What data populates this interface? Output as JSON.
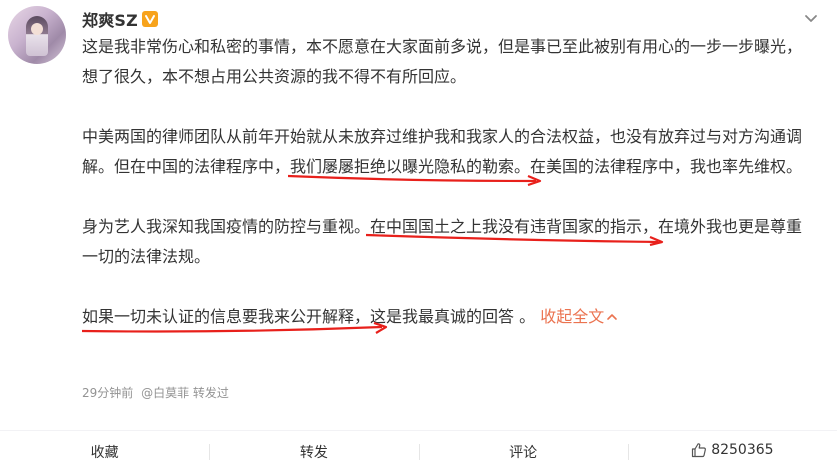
{
  "post": {
    "username": "郑爽SZ",
    "verified_icon": "v-badge-icon",
    "paragraphs": {
      "p1": "这是我非常伤心和私密的事情，本不愿意在大家面前多说，但是事已至此被别有用心的一步一步曝光，想了很久，本不想占用公共资源的我不得不有所回应。",
      "p2_a": "中美两国的律师团队从前年开始就从未放弃过维护我和我家人的合法权益，也没有放弃过与对方沟通调解。但在中国的法律程序中，",
      "p2_hl": "我们屡屡拒绝以曝光隐私的勒索",
      "p2_b": "。在美国的法律程序中，我也率先维权。",
      "p3_a": "身为艺人我深知我国疫情的防控与重视。",
      "p3_hl": "在中国国土之上我没有违背国家的指示",
      "p3_b": "，在境外我也更是尊重一切的法律法规。",
      "p4_hl": "如果一切未认证的信息要我来公开解释",
      "p4_b": "，这是我最真诚的回答 。 ",
      "collapse": "收起全文"
    },
    "meta": {
      "time": "29分钟前",
      "source": "@白莫菲 转发过"
    },
    "colors": {
      "accent": "#eb7350",
      "highlight_line": "#e8201b",
      "verified_badge": "#f7a31c"
    }
  },
  "actions": {
    "favorite": "收藏",
    "repost": "转发",
    "comment": "评论",
    "like_count": "8250365"
  }
}
